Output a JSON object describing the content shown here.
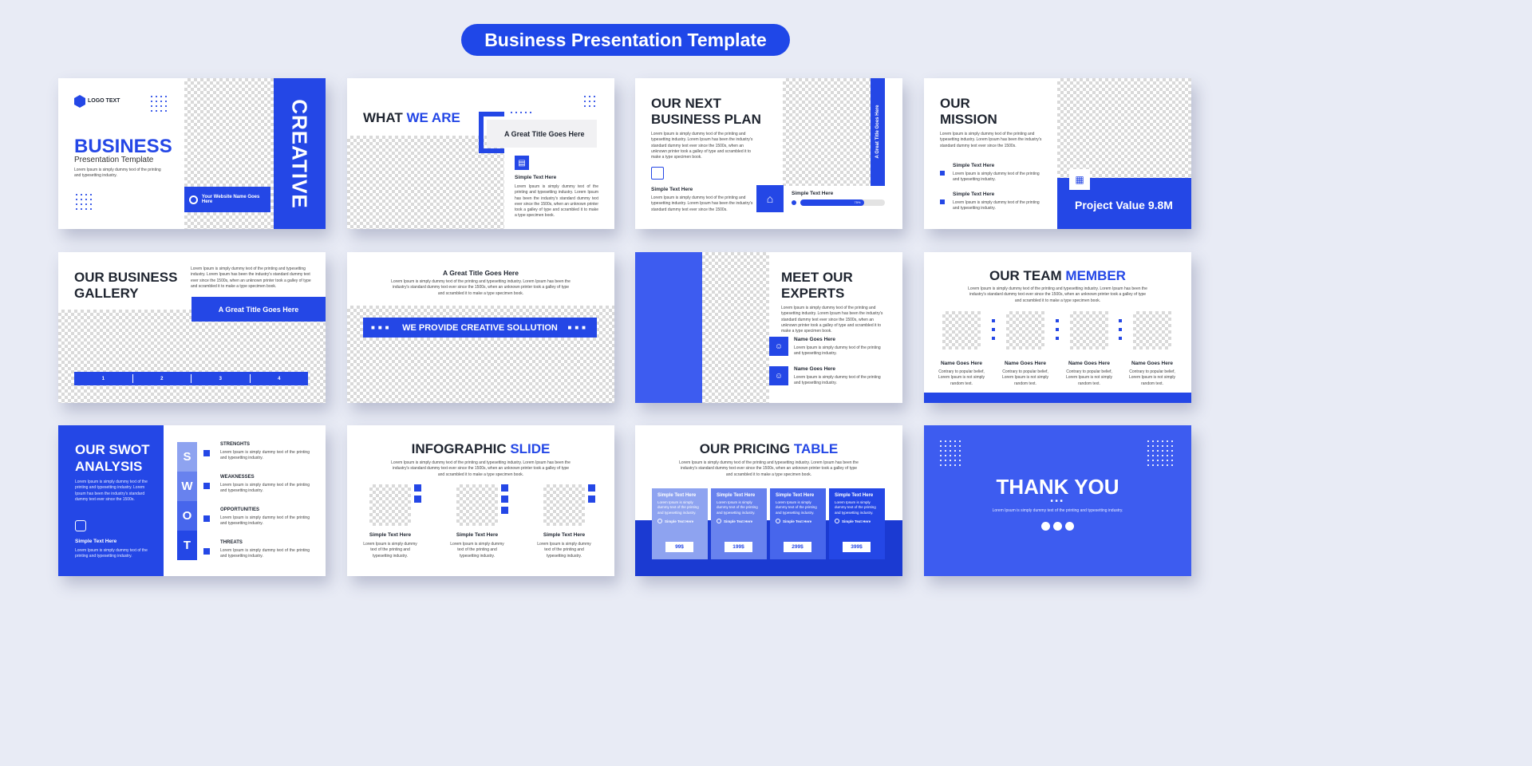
{
  "header": {
    "title": "Business Presentation Template"
  },
  "colors": {
    "primary": "#2447e6",
    "background": "#e8ebf5",
    "dark": "#1f2530"
  },
  "slides": {
    "s1": {
      "logo": "LOGO TEXT",
      "title": "BUSINESS",
      "subtitle": "Presentation Template",
      "body": "Lorem Ipsum is simply dummy text of the printing and typesetting industry.",
      "vertical": "CREATIVE",
      "website": "Your Website Name Goes Here",
      "icon": "globe-icon"
    },
    "s2": {
      "title_a": "WHAT ",
      "title_b": "WE ARE",
      "box_title": "A Great Title Goes Here",
      "item_title": "Simple Text Here",
      "item_body": "Lorem Ipsum is simply dummy text of the printing and typesetting industry. Lorem Ipsum has been the industry's standard dummy text ever since the 1500s, when an unknown printer took a galley of type and scrambled it to make a type specimen book."
    },
    "s3": {
      "title_a": "OUR NEXT",
      "title_b": "BUSINESS PLAN",
      "body": "Lorem Ipsum is simply dummy text of the printing and typesetting industry. Lorem Ipsum has been the industry's standard dummy text ever since the 1500s, when an unknown printer took a galley of type and scrambled it to make a type specimen book.",
      "item_title": "Simple Text Here",
      "item_body": "Lorem Ipsum is simply dummy text of the printing and typesetting industry. Lorem Ipsum has been the industry's standard dummy text ever since the 1500s.",
      "vertical": "A Great Title Goes Here",
      "progress_title": "Simple Text Here",
      "progress_label": "75%",
      "progress_value": 0.75
    },
    "s4": {
      "title_a": "OUR",
      "title_b": "MISSION",
      "body": "Lorem Ipsum is simply dummy text of the printing and typesetting industry. Lorem Ipsum has been the industry's standard dummy text ever since the 1500s.",
      "items": [
        {
          "title": "Simple Text Here",
          "body": "Lorem Ipsum is simply dummy text of the printing and typesetting industry."
        },
        {
          "title": "Simple Text Here",
          "body": "Lorem Ipsum is simply dummy text of the printing and typesetting industry."
        }
      ],
      "value": "Project Value 9.8M"
    },
    "s5": {
      "title_a": "OUR BUSINESS",
      "title_b": "GALLERY",
      "body": "Lorem Ipsum is simply dummy text of the printing and typesetting industry. Lorem Ipsum has been the industry's standard dummy text ever since the 1500s, when an unknown printer took a galley of type and scrambled it to make a type specimen book.",
      "banner": "A Great Title Goes Here",
      "steps": [
        "1",
        "2",
        "3",
        "4"
      ]
    },
    "s6": {
      "title": "A Great Title Goes Here",
      "body": "Lorem Ipsum is simply dummy text of the printing and typesetting industry. Lorem Ipsum has been the industry's standard dummy text ever since the 1500s, when an unknown printer took a galley of type and scrambled it to make a type specimen book.",
      "banner": "WE PROVIDE CREATIVE SOLLUTION"
    },
    "s7": {
      "title_a": "MEET OUR",
      "title_b": "EXPERTS",
      "body": "Lorem Ipsum is simply dummy text of the printing and typesetting industry. Lorem Ipsum has been the industry's standard dummy text ever since the 1500s, when an unknown printer took a galley of type and scrambled it to make a type specimen book.",
      "experts": [
        {
          "name": "Name Goes Here",
          "body": "Lorem Ipsum is simply dummy text of the printing and typesetting industry."
        },
        {
          "name": "Name Goes Here",
          "body": "Lorem Ipsum is simply dummy text of the printing and typesetting industry."
        }
      ]
    },
    "s8": {
      "title_a": "OUR TEAM ",
      "title_b": "MEMBER",
      "body": "Lorem Ipsum is simply dummy text of the printing and typesetting industry. Lorem Ipsum has been the industry's standard dummy text ever since the 1500s, when an unknown printer took a galley of type and scrambled it to make a type specimen book.",
      "members": [
        {
          "name": "Name Goes Here",
          "body": "Contrary to popular belief, Lorem Ipsum is not simply random text."
        },
        {
          "name": "Name Goes Here",
          "body": "Contrary to popular belief, Lorem Ipsum is not simply random text."
        },
        {
          "name": "Name Goes Here",
          "body": "Contrary to popular belief, Lorem Ipsum is not simply random text."
        },
        {
          "name": "Name Goes Here",
          "body": "Contrary to popular belief, Lorem Ipsum is not simply random text."
        }
      ]
    },
    "s9": {
      "title_a": "OUR SWOT",
      "title_b": "ANALYSIS",
      "body": "Lorem Ipsum is simply dummy text of the printing and typesetting industry. Lorem Ipsum has been the industry's standard dummy text ever since the 1500s.",
      "item_title": "Simple Text Here",
      "item_body": "Lorem Ipsum is simply dummy text of the printing and typesetting industry.",
      "letters": [
        "S",
        "W",
        "O",
        "T"
      ],
      "rows": [
        {
          "title": "STRENGHTS",
          "body": "Lorem Ipsum is simply dummy text of the printing and typesetting industry."
        },
        {
          "title": "WEAKNESSES",
          "body": "Lorem Ipsum is simply dummy text of the printing and typesetting industry."
        },
        {
          "title": "OPPORTUNITIES",
          "body": "Lorem Ipsum is simply dummy text of the printing and typesetting industry."
        },
        {
          "title": "THREATS",
          "body": "Lorem Ipsum is simply dummy text of the printing and typesetting industry."
        }
      ]
    },
    "s10": {
      "title_a": "INFOGRAPHIC ",
      "title_b": "SLIDE",
      "body": "Lorem Ipsum is simply dummy text of the printing and typesetting industry. Lorem Ipsum has been the industry's standard dummy text ever since the 1500s, when an unknown printer took a galley of type and scrambled it to make a type specimen book.",
      "items": [
        {
          "title": "Simple Text Here",
          "body": "Lorem Ipsum is simply dummy text of the printing and typesetting industry."
        },
        {
          "title": "Simple Text Here",
          "body": "Lorem Ipsum is simply dummy text of the printing and typesetting industry."
        },
        {
          "title": "Simple Text Here",
          "body": "Lorem Ipsum is simply dummy text of the printing and typesetting industry."
        }
      ]
    },
    "s11": {
      "title_a": "OUR PRICING ",
      "title_b": "TABLE",
      "body": "Lorem Ipsum is simply dummy text of the printing and typesetting industry. Lorem Ipsum has been the industry's standard dummy text ever since the 1500s, when an unknown printer took a galley of type and scrambled it to make a type specimen book.",
      "plans": [
        {
          "title": "Simple Text Here",
          "body": "Lorem Ipsum is simply dummy text of the printing and typesetting industry.",
          "feature": "Simple Text Here",
          "price": "99$",
          "color": "#8ea3f0"
        },
        {
          "title": "Simple Text Here",
          "body": "Lorem Ipsum is simply dummy text of the printing and typesetting industry.",
          "feature": "Simple Text Here",
          "price": "199$",
          "color": "#6882ee"
        },
        {
          "title": "Simple Text Here",
          "body": "Lorem Ipsum is simply dummy text of the printing and typesetting industry.",
          "feature": "Simple Text Here",
          "price": "299$",
          "color": "#4766ec"
        },
        {
          "title": "Simple Text Here",
          "body": "Lorem Ipsum is simply dummy text of the printing and typesetting industry.",
          "feature": "Simple Text Here",
          "price": "399$",
          "color": "#2447e6"
        }
      ]
    },
    "s12": {
      "title": "THANK YOU",
      "body": "Lorem Ipsum is simply dummy text of the printing and typesetting industry."
    }
  }
}
